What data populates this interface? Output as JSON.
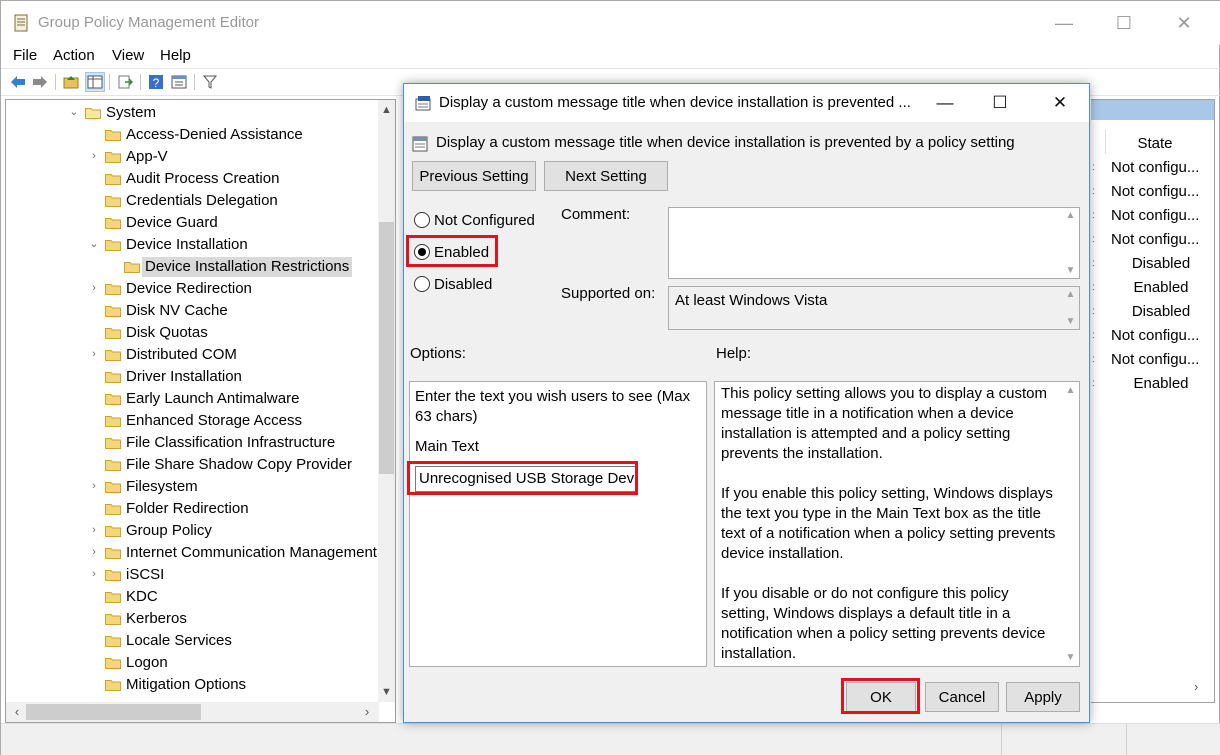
{
  "window": {
    "title": "Group Policy Management Editor",
    "minimize": "—",
    "maximize": "☐",
    "close": "✕"
  },
  "menu": [
    "File",
    "Action",
    "View",
    "Help"
  ],
  "tree": {
    "root": "System",
    "items": [
      {
        "label": "Access-Denied Assistance",
        "chevron": ""
      },
      {
        "label": "App-V",
        "chevron": "›"
      },
      {
        "label": "Audit Process Creation",
        "chevron": ""
      },
      {
        "label": "Credentials Delegation",
        "chevron": ""
      },
      {
        "label": "Device Guard",
        "chevron": ""
      },
      {
        "label": "Device Installation",
        "chevron": "⌄"
      },
      {
        "label": "Device Installation Restrictions",
        "chevron": "",
        "child": true,
        "selected": true
      },
      {
        "label": "Device Redirection",
        "chevron": "›"
      },
      {
        "label": "Disk NV Cache",
        "chevron": ""
      },
      {
        "label": "Disk Quotas",
        "chevron": ""
      },
      {
        "label": "Distributed COM",
        "chevron": "›"
      },
      {
        "label": "Driver Installation",
        "chevron": ""
      },
      {
        "label": "Early Launch Antimalware",
        "chevron": ""
      },
      {
        "label": "Enhanced Storage Access",
        "chevron": ""
      },
      {
        "label": "File Classification Infrastructure",
        "chevron": ""
      },
      {
        "label": "File Share Shadow Copy Provider",
        "chevron": ""
      },
      {
        "label": "Filesystem",
        "chevron": "›"
      },
      {
        "label": "Folder Redirection",
        "chevron": ""
      },
      {
        "label": "Group Policy",
        "chevron": "›"
      },
      {
        "label": "Internet Communication Management",
        "chevron": "›"
      },
      {
        "label": "iSCSI",
        "chevron": "›"
      },
      {
        "label": "KDC",
        "chevron": ""
      },
      {
        "label": "Kerberos",
        "chevron": ""
      },
      {
        "label": "Locale Services",
        "chevron": ""
      },
      {
        "label": "Logon",
        "chevron": ""
      },
      {
        "label": "Mitigation Options",
        "chevron": ""
      }
    ]
  },
  "state_column": {
    "header": "State",
    "values": [
      "Not configu...",
      "Not configu...",
      "Not configu...",
      "Not configu...",
      "Disabled",
      "Enabled",
      "Disabled",
      "Not configu...",
      "Not configu...",
      "Enabled"
    ]
  },
  "dialog": {
    "title": "Display a custom message title when device installation is prevented ...",
    "subtitle": "Display a custom message title when device installation is prevented by a policy setting",
    "prev_button": "Previous Setting",
    "next_button": "Next Setting",
    "radio_not_configured": "Not Configured",
    "radio_enabled": "Enabled",
    "radio_disabled": "Disabled",
    "comment_label": "Comment:",
    "comment_value": "",
    "supported_label": "Supported on:",
    "supported_value": "At least Windows Vista",
    "options_label": "Options:",
    "help_label": "Help:",
    "options_prompt": "Enter the text you wish users to see (Max 63 chars)",
    "main_text_label": "Main Text",
    "main_text_value": "Unrecognised USB Storage Device",
    "help_paragraphs": [
      "This policy setting allows you to display a custom message title in a notification when a device installation is attempted and a policy setting prevents the installation.",
      "If you enable this policy setting, Windows displays the text you type in the Main Text box as the title text of a notification when a policy setting prevents device installation.",
      "If you disable or do not configure this policy setting, Windows displays a default title in a notification when a policy setting prevents device installation."
    ],
    "ok_button": "OK",
    "cancel_button": "Cancel",
    "apply_button": "Apply"
  },
  "colors": {
    "highlight": "#e0141e",
    "dialog_border": "#4a8fd4",
    "dialog_bg": "#f0f0f0"
  }
}
